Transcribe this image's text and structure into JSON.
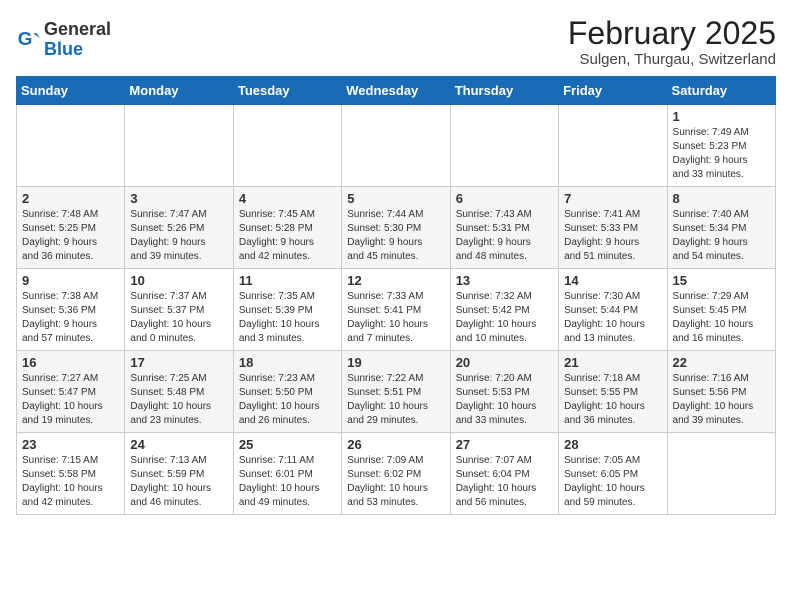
{
  "header": {
    "logo_general": "General",
    "logo_blue": "Blue",
    "month_title": "February 2025",
    "subtitle": "Sulgen, Thurgau, Switzerland"
  },
  "weekdays": [
    "Sunday",
    "Monday",
    "Tuesday",
    "Wednesday",
    "Thursday",
    "Friday",
    "Saturday"
  ],
  "weeks": [
    [
      {
        "day": "",
        "info": ""
      },
      {
        "day": "",
        "info": ""
      },
      {
        "day": "",
        "info": ""
      },
      {
        "day": "",
        "info": ""
      },
      {
        "day": "",
        "info": ""
      },
      {
        "day": "",
        "info": ""
      },
      {
        "day": "1",
        "info": "Sunrise: 7:49 AM\nSunset: 5:23 PM\nDaylight: 9 hours\nand 33 minutes."
      }
    ],
    [
      {
        "day": "2",
        "info": "Sunrise: 7:48 AM\nSunset: 5:25 PM\nDaylight: 9 hours\nand 36 minutes."
      },
      {
        "day": "3",
        "info": "Sunrise: 7:47 AM\nSunset: 5:26 PM\nDaylight: 9 hours\nand 39 minutes."
      },
      {
        "day": "4",
        "info": "Sunrise: 7:45 AM\nSunset: 5:28 PM\nDaylight: 9 hours\nand 42 minutes."
      },
      {
        "day": "5",
        "info": "Sunrise: 7:44 AM\nSunset: 5:30 PM\nDaylight: 9 hours\nand 45 minutes."
      },
      {
        "day": "6",
        "info": "Sunrise: 7:43 AM\nSunset: 5:31 PM\nDaylight: 9 hours\nand 48 minutes."
      },
      {
        "day": "7",
        "info": "Sunrise: 7:41 AM\nSunset: 5:33 PM\nDaylight: 9 hours\nand 51 minutes."
      },
      {
        "day": "8",
        "info": "Sunrise: 7:40 AM\nSunset: 5:34 PM\nDaylight: 9 hours\nand 54 minutes."
      }
    ],
    [
      {
        "day": "9",
        "info": "Sunrise: 7:38 AM\nSunset: 5:36 PM\nDaylight: 9 hours\nand 57 minutes."
      },
      {
        "day": "10",
        "info": "Sunrise: 7:37 AM\nSunset: 5:37 PM\nDaylight: 10 hours\nand 0 minutes."
      },
      {
        "day": "11",
        "info": "Sunrise: 7:35 AM\nSunset: 5:39 PM\nDaylight: 10 hours\nand 3 minutes."
      },
      {
        "day": "12",
        "info": "Sunrise: 7:33 AM\nSunset: 5:41 PM\nDaylight: 10 hours\nand 7 minutes."
      },
      {
        "day": "13",
        "info": "Sunrise: 7:32 AM\nSunset: 5:42 PM\nDaylight: 10 hours\nand 10 minutes."
      },
      {
        "day": "14",
        "info": "Sunrise: 7:30 AM\nSunset: 5:44 PM\nDaylight: 10 hours\nand 13 minutes."
      },
      {
        "day": "15",
        "info": "Sunrise: 7:29 AM\nSunset: 5:45 PM\nDaylight: 10 hours\nand 16 minutes."
      }
    ],
    [
      {
        "day": "16",
        "info": "Sunrise: 7:27 AM\nSunset: 5:47 PM\nDaylight: 10 hours\nand 19 minutes."
      },
      {
        "day": "17",
        "info": "Sunrise: 7:25 AM\nSunset: 5:48 PM\nDaylight: 10 hours\nand 23 minutes."
      },
      {
        "day": "18",
        "info": "Sunrise: 7:23 AM\nSunset: 5:50 PM\nDaylight: 10 hours\nand 26 minutes."
      },
      {
        "day": "19",
        "info": "Sunrise: 7:22 AM\nSunset: 5:51 PM\nDaylight: 10 hours\nand 29 minutes."
      },
      {
        "day": "20",
        "info": "Sunrise: 7:20 AM\nSunset: 5:53 PM\nDaylight: 10 hours\nand 33 minutes."
      },
      {
        "day": "21",
        "info": "Sunrise: 7:18 AM\nSunset: 5:55 PM\nDaylight: 10 hours\nand 36 minutes."
      },
      {
        "day": "22",
        "info": "Sunrise: 7:16 AM\nSunset: 5:56 PM\nDaylight: 10 hours\nand 39 minutes."
      }
    ],
    [
      {
        "day": "23",
        "info": "Sunrise: 7:15 AM\nSunset: 5:58 PM\nDaylight: 10 hours\nand 42 minutes."
      },
      {
        "day": "24",
        "info": "Sunrise: 7:13 AM\nSunset: 5:59 PM\nDaylight: 10 hours\nand 46 minutes."
      },
      {
        "day": "25",
        "info": "Sunrise: 7:11 AM\nSunset: 6:01 PM\nDaylight: 10 hours\nand 49 minutes."
      },
      {
        "day": "26",
        "info": "Sunrise: 7:09 AM\nSunset: 6:02 PM\nDaylight: 10 hours\nand 53 minutes."
      },
      {
        "day": "27",
        "info": "Sunrise: 7:07 AM\nSunset: 6:04 PM\nDaylight: 10 hours\nand 56 minutes."
      },
      {
        "day": "28",
        "info": "Sunrise: 7:05 AM\nSunset: 6:05 PM\nDaylight: 10 hours\nand 59 minutes."
      },
      {
        "day": "",
        "info": ""
      }
    ]
  ]
}
